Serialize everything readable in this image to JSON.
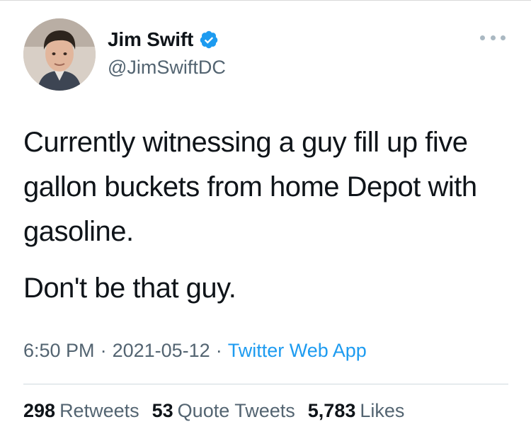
{
  "author": {
    "name": "Jim Swift",
    "handle": "@JimSwiftDC",
    "verified": true
  },
  "tweet": {
    "paragraphs": [
      "Currently witnessing a guy fill up five gallon buckets from home Depot with gasoline.",
      "Don't be that guy."
    ]
  },
  "meta": {
    "time": "6:50 PM",
    "separator": "·",
    "date": "2021-05-12",
    "source": "Twitter Web App"
  },
  "stats": {
    "retweets": {
      "count": "298",
      "label": "Retweets"
    },
    "quotes": {
      "count": "53",
      "label": "Quote Tweets"
    },
    "likes": {
      "count": "5,783",
      "label": "Likes"
    }
  },
  "colors": {
    "text": "#0f1419",
    "secondary": "#536471",
    "accent": "#1d9bf0"
  },
  "icons": {
    "verified": "verified-badge-icon",
    "more": "more-options-icon"
  }
}
